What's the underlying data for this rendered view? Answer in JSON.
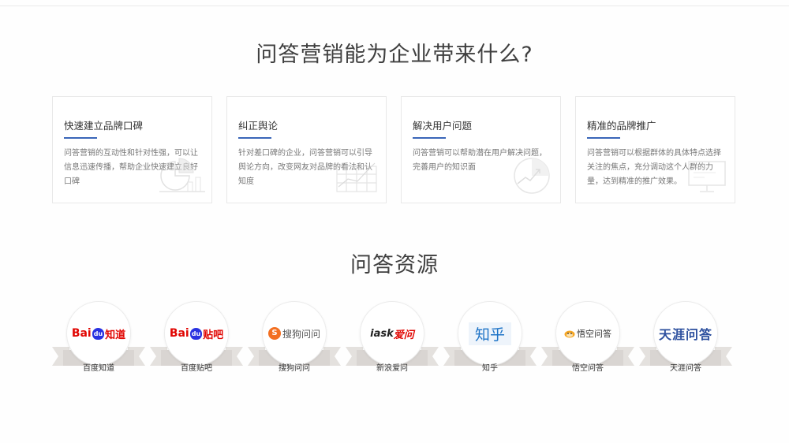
{
  "section1": {
    "title": "问答营销能为企业带来什么?",
    "cards": [
      {
        "title": "快速建立品牌口碑",
        "text": "问答营销的互动性和针对性强，可以让信息迅速传播，帮助企业快速建立良好口碑",
        "icon": "pie-chart-icon"
      },
      {
        "title": "纠正舆论",
        "text": "针对差口碑的企业，问答营销可以引导舆论方向，改变网友对品牌的看法和认知度",
        "icon": "bar-chart-icon"
      },
      {
        "title": "解决用户问题",
        "text": "问答营销可以帮助潜在用户解决问题，完善用户的知识面",
        "icon": "growth-chart-icon"
      },
      {
        "title": "精准的品牌推广",
        "text": "问答营销可以根据群体的具体特点选择关注的焦点，充分调动这个人群的力量，达到精准的推广效果。",
        "icon": "monitor-icon"
      }
    ]
  },
  "section2": {
    "title": "问答资源",
    "items": [
      {
        "label": "百度知道",
        "logo_a": "Bai",
        "logo_paw": "du",
        "logo_b": "知道",
        "icon": "baidu-zhidao-logo"
      },
      {
        "label": "百度贴吧",
        "logo_a": "Bai",
        "logo_paw": "du",
        "logo_b": "贴吧",
        "icon": "baidu-tieba-logo"
      },
      {
        "label": "搜狗问问",
        "logo_s": "S",
        "logo_b": "搜狗问问",
        "icon": "sogou-wenwen-logo"
      },
      {
        "label": "新浪爱问",
        "logo_a": "iask",
        "logo_b": "爱问",
        "icon": "sina-iask-logo"
      },
      {
        "label": "知乎",
        "logo_b": "知乎",
        "icon": "zhihu-logo"
      },
      {
        "label": "悟空问答",
        "logo_b": "悟空问答",
        "icon": "wukong-logo"
      },
      {
        "label": "天涯问答",
        "logo_b": "天涯问答",
        "icon": "tianya-logo"
      }
    ]
  },
  "colors": {
    "accent": "#3a66b8",
    "baidu_red": "#e10602",
    "baidu_blue": "#2932e1",
    "ribbon": "#dedad7"
  }
}
